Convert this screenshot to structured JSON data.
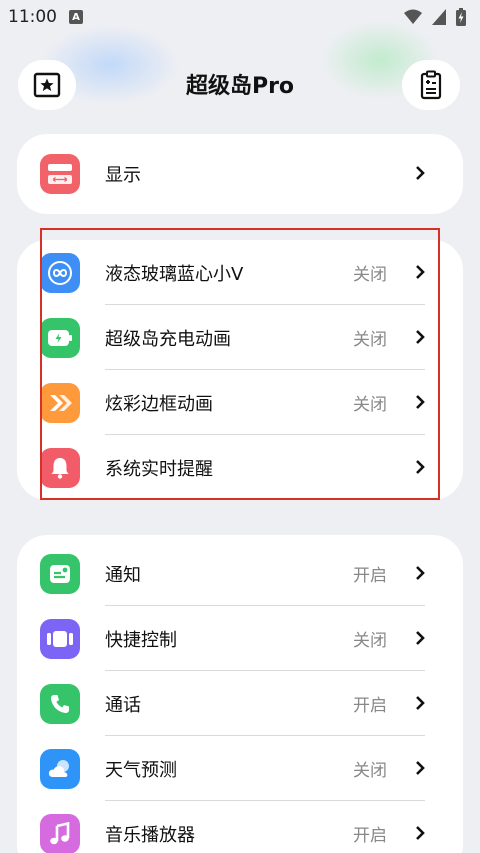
{
  "status_bar": {
    "time": "11:00",
    "notification_icon": "A"
  },
  "header": {
    "title": "超级岛Pro",
    "left_icon": "star-icon",
    "right_icon": "clipboard-icon"
  },
  "section1": {
    "items": [
      {
        "label": "显示",
        "value": "",
        "icon": "display-icon",
        "color": "#f26269"
      }
    ]
  },
  "section2": {
    "items": [
      {
        "label": "液态玻璃蓝心小V",
        "value": "关闭",
        "icon": "infinity-icon",
        "color": "#3d8ff6"
      },
      {
        "label": "超级岛充电动画",
        "value": "关闭",
        "icon": "battery-charge-icon",
        "color": "#35c46a"
      },
      {
        "label": "炫彩边框动画",
        "value": "关闭",
        "icon": "chevrons-icon",
        "color": "#ff9a3c"
      },
      {
        "label": "系统实时提醒",
        "value": "",
        "icon": "bell-icon",
        "color": "#f25c68"
      }
    ]
  },
  "section3": {
    "items": [
      {
        "label": "通知",
        "value": "开启",
        "icon": "notification-icon",
        "color": "#35c46a"
      },
      {
        "label": "快捷控制",
        "value": "关闭",
        "icon": "shortcut-icon",
        "color": "#7c64f5"
      },
      {
        "label": "通话",
        "value": "开启",
        "icon": "phone-icon",
        "color": "#35c46a"
      },
      {
        "label": "天气预测",
        "value": "关闭",
        "icon": "weather-icon",
        "color": "#2f94f7"
      },
      {
        "label": "音乐播放器",
        "value": "开启",
        "icon": "music-icon",
        "color": "#d66be0"
      }
    ]
  }
}
